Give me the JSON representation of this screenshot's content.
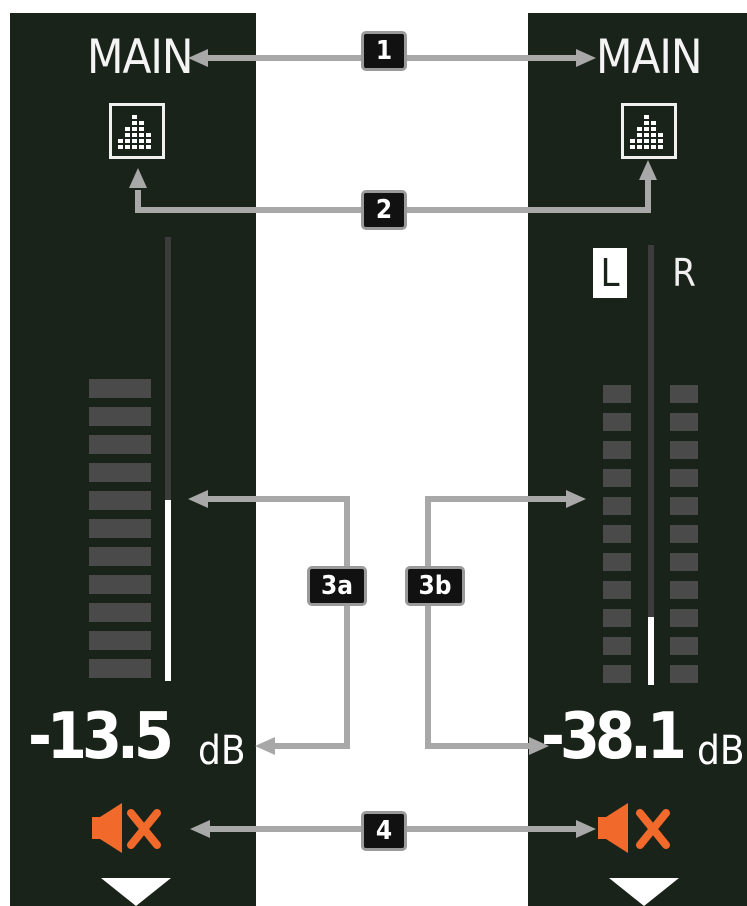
{
  "left_channel": {
    "title": "MAIN",
    "db_value": "-13.5",
    "db_unit": "dB",
    "eq_icon": "equalizer-icon",
    "mute_icon": "speaker-muted-icon",
    "dropdown_icon": "triangle-down-icon",
    "meter_level_fraction": 0.41
  },
  "right_channel": {
    "title": "MAIN",
    "left_label": "L",
    "right_label": "R",
    "db_value": "-38.1",
    "db_unit": "dB",
    "eq_icon": "equalizer-icon",
    "mute_icon": "speaker-muted-icon",
    "dropdown_icon": "triangle-down-icon",
    "meter_level_fraction": 0.16
  },
  "callouts": {
    "c1": "1",
    "c2": "2",
    "c3a": "3a",
    "c3b": "3b",
    "c4": "4"
  },
  "colors": {
    "strip_background": "#1a2319",
    "mute_icon": "#f26a2b",
    "arrow": "#a8a8a8",
    "meter_segment": "#4a4a4a",
    "callout_background": "#111111"
  }
}
